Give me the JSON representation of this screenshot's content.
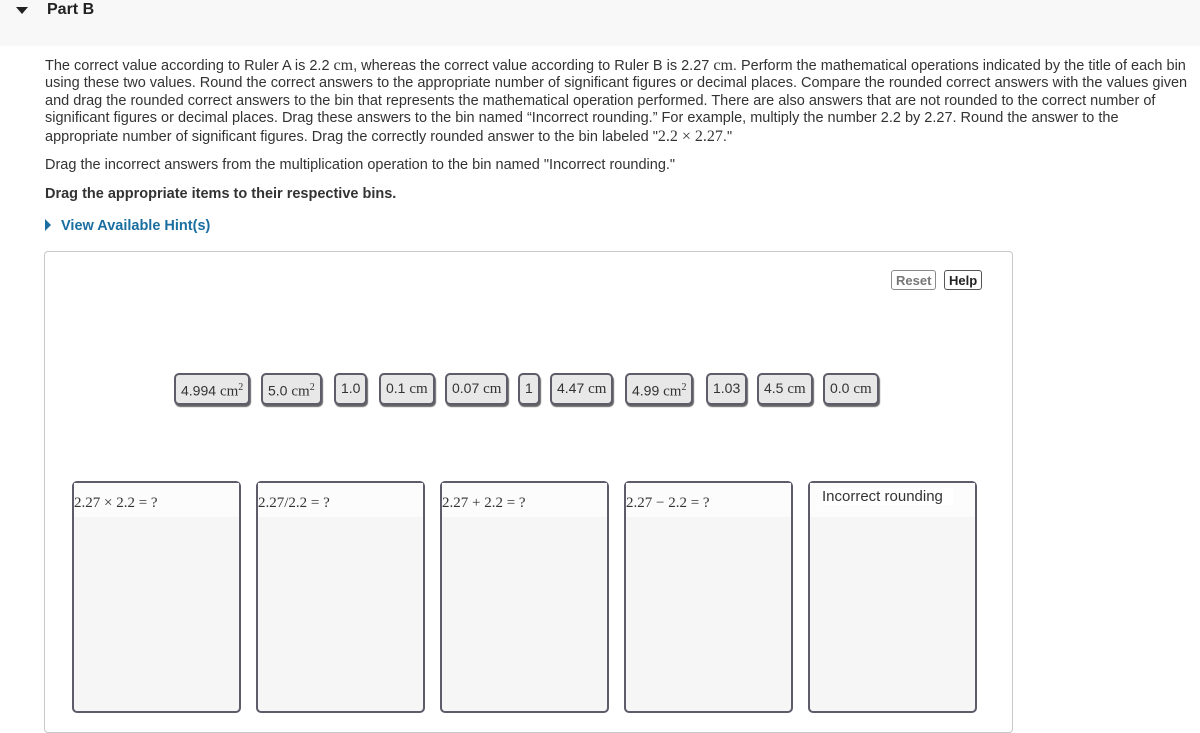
{
  "part": {
    "title": "Part B"
  },
  "intro": {
    "s1": "The correct value according to Ruler A is 2.2 ",
    "unit": "cm",
    "s2": ", whereas the correct value according to Ruler B is 2.27 ",
    "s3": ". Perform the mathematical operations indicated by the title of each bin using these two values. Round the correct answers to the appropriate number of significant figures or decimal places. Compare the rounded correct answers with the values given and drag the rounded correct answers to the bin that represents the mathematical operation performed. There are also answers that are not rounded to the correct number of significant figures or decimal places. Drag these answers to the bin named “Incorrect rounding.” For example, multiply the number 2.2 by 2.27. Round the answer to the appropriate number of significant figures. Drag the correctly rounded answer  to the bin labeled \"",
    "expr": "2.2 × 2.27",
    "s4": ".\""
  },
  "instructions": {
    "incorrect": "Drag the incorrect answers from the multiplication operation to the bin named \"Incorrect rounding.\"",
    "bold": "Drag the appropriate items to their respective bins.",
    "hint_link": "View Available Hint(s)"
  },
  "toolbar": {
    "reset_label": "Reset",
    "help_label": "Help"
  },
  "tiles": [
    {
      "num": "4.994 ",
      "unit": "cm",
      "sup": "2"
    },
    {
      "num": "5.0 ",
      "unit": "cm",
      "sup": "2"
    },
    {
      "num": "1.0",
      "unit": "",
      "sup": ""
    },
    {
      "num": "0.1 ",
      "unit": "cm",
      "sup": ""
    },
    {
      "num": "0.07 ",
      "unit": "cm",
      "sup": ""
    },
    {
      "num": "1",
      "unit": "",
      "sup": ""
    },
    {
      "num": "4.47 ",
      "unit": "cm",
      "sup": ""
    },
    {
      "num": "4.99 ",
      "unit": "cm",
      "sup": "2"
    },
    {
      "num": "1.03",
      "unit": "",
      "sup": ""
    },
    {
      "num": "4.5 ",
      "unit": "cm",
      "sup": ""
    },
    {
      "num": "0.0 ",
      "unit": "cm",
      "sup": ""
    }
  ],
  "bins": [
    {
      "title": "2.27 × 2.2 = ?"
    },
    {
      "title": "2.27/2.2 = ?"
    },
    {
      "title": "2.27 + 2.2 = ?"
    },
    {
      "title": "2.27 − 2.2 = ?"
    },
    {
      "title": "Incorrect rounding"
    }
  ]
}
